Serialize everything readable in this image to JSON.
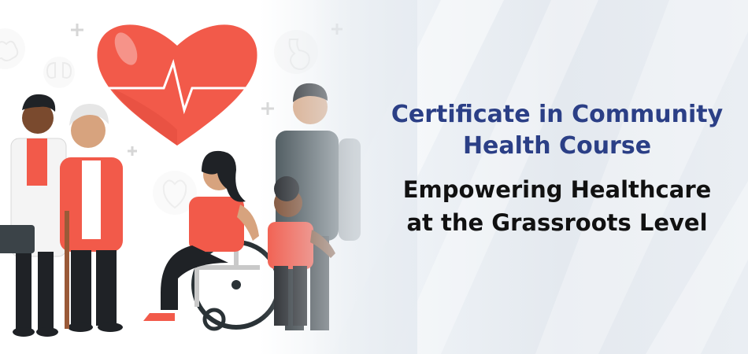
{
  "banner": {
    "title_line1": "Certificate in Community",
    "title_line2": "Health Course",
    "subtitle_line1": "Empowering Healthcare",
    "subtitle_line2": "at the Grassroots Level"
  },
  "colors": {
    "title": "#2b3f86",
    "subtitle": "#111111",
    "accent_red": "#f25a4a",
    "dark_clothing": "#2a3236",
    "background": "#eef2f6"
  },
  "illustration": {
    "icons": [
      "heart-icon",
      "heartbeat-line-icon",
      "plus-icon",
      "lungs-icon",
      "brain-icon",
      "stomach-icon",
      "anatomical-heart-icon",
      "clipboard-icon"
    ],
    "figures": [
      "doctor",
      "elderly-woman-with-cane",
      "woman-in-wheelchair",
      "man",
      "child"
    ]
  }
}
